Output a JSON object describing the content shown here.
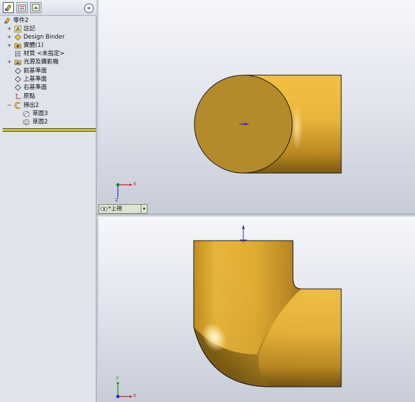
{
  "feature_manager": {
    "expand_symbol": "»",
    "root_label": "零件2",
    "items": [
      {
        "label": "註記",
        "expand": "+"
      },
      {
        "label": "Design Binder",
        "expand": "+"
      },
      {
        "label": "實體(1)",
        "expand": "+"
      },
      {
        "label": "材質 <未指定>",
        "expand": ""
      },
      {
        "label": "光源及攝影機",
        "expand": "+"
      },
      {
        "label": "前基準面",
        "expand": ""
      },
      {
        "label": "上基準面",
        "expand": ""
      },
      {
        "label": "右基準面",
        "expand": ""
      },
      {
        "label": "原點",
        "expand": ""
      },
      {
        "label": "掃出2",
        "expand": "−"
      },
      {
        "label": "草圖3",
        "expand": ""
      },
      {
        "label": "草圖2",
        "expand": ""
      }
    ]
  },
  "viewport": {
    "top_view_label": "*上視",
    "triad_top": {
      "x": "X",
      "z": "Z"
    },
    "triad_front": {
      "x": "X",
      "y": "Y"
    }
  },
  "colors": {
    "part_gold": "#d6a12a",
    "sketch_blue": "#2a2ac8",
    "axis_red": "#cc2222",
    "axis_green": "#1a8a1a",
    "axis_blue": "#2233bb"
  }
}
